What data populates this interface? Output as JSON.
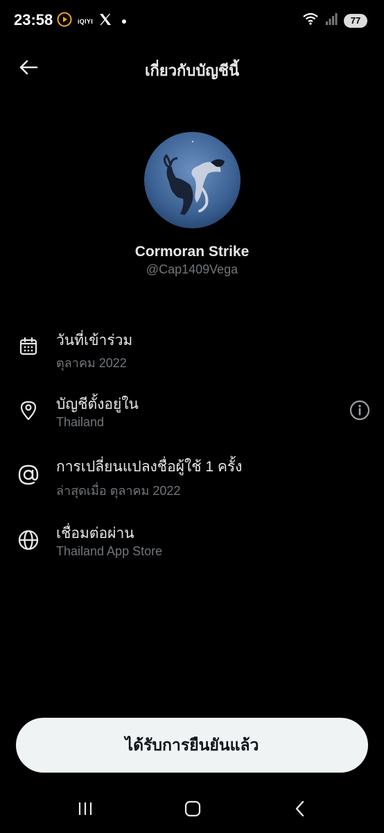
{
  "status_bar": {
    "time": "23:58",
    "iqiyi_label": "iQIYI",
    "battery": "77"
  },
  "header": {
    "title": "เกี่ยวกับบัญชีนี้"
  },
  "profile": {
    "display_name": "Cormoran Strike",
    "username": "@Cap1409Vega"
  },
  "info": [
    {
      "icon": "calendar-icon",
      "title": "วันที่เข้าร่วม",
      "subtitle": "ตุลาคม 2022"
    },
    {
      "icon": "location-pin-icon",
      "title": "บัญชีตั้งอยู่ใน",
      "subtitle": "Thailand"
    },
    {
      "icon": "at-sign-icon",
      "title": "การเปลี่ยนแปลงชื่อผู้ใช้ 1 ครั้ง",
      "subtitle": "ล่าสุดเมื่อ ตุลาคม 2022"
    },
    {
      "icon": "globe-icon",
      "title": "เชื่อมต่อผ่าน",
      "subtitle": "Thailand App Store"
    }
  ],
  "verified_button": {
    "label": "ได้รับการยืนยันแล้ว"
  },
  "colors": {
    "background": "#000000",
    "primary_text": "#e7e9ea",
    "secondary_text": "#71767b",
    "button_bg": "#eff3f4"
  }
}
